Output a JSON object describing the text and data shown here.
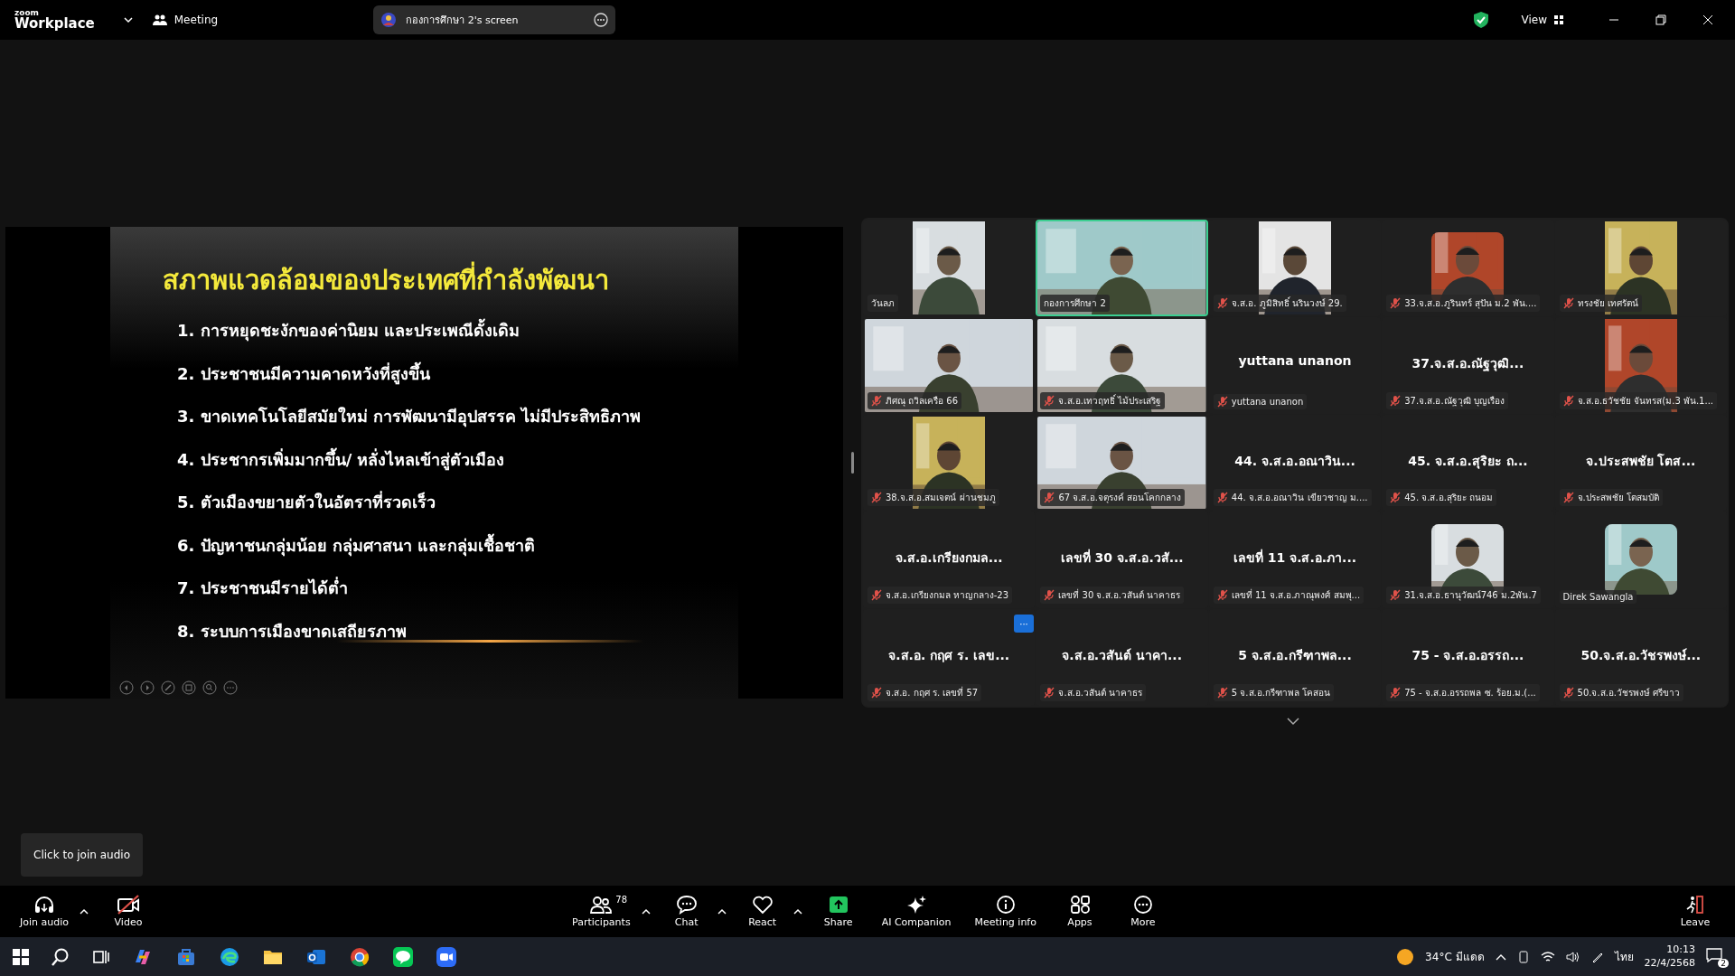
{
  "topbar": {
    "logo_small": "zoom",
    "logo_name": "Workplace",
    "meeting_label": "Meeting",
    "share_pill": "กองการศึกษา 2's screen",
    "view_label": "View"
  },
  "slide": {
    "title": "สภาพแวดล้อมของประเทศที่กำลังพัฒนา",
    "items": [
      "1. การหยุดชะงักของค่านิยม และประเพณีดั้งเดิม",
      "2. ประชาชนมีความคาดหวังที่สูงขึ้น",
      "3. ขาดเทคโนโลยีสมัยใหม่ การพัฒนามีอุปสรรค ไม่มีประสิทธิภาพ",
      "4. ประชากรเพิ่มมากขึ้น/ หลั่งไหลเข้าสู่ตัวเมือง",
      "5. ตัวเมืองขยายตัวในอัตราที่รวดเร็ว",
      "6. ปัญหาชนกลุ่มน้อย  กลุ่มศาสนา  และกลุ่มเชื้อชาติ",
      "7. ประชาชนมีรายได้ต่ำ",
      "8. ระบบการเมืองขาดเสถียรภาพ"
    ]
  },
  "gallery": {
    "more_button": "···",
    "tiles": [
      {
        "kind": "narrow",
        "label": "วันลภ",
        "muted": false,
        "selected": false
      },
      {
        "kind": "wide",
        "label": "กองการศึกษา 2",
        "muted": false,
        "selected": true
      },
      {
        "kind": "narrow",
        "label": "จ.ส.อ. ภูมิสิทธิ์ นรินวงษ์ 29.",
        "muted": true,
        "selected": false
      },
      {
        "label": "33.จ.ส.อ.ภูรินทร์ สุปัน ม.2 พัน....",
        "muted": true,
        "selected": false
      },
      {
        "kind": "narrow",
        "label": "ทรงชัย  เทศรัตน์",
        "muted": true,
        "selected": false
      },
      {
        "kind": "wide",
        "label": "ภิศณุ ถวิลเครือ  66",
        "muted": true,
        "selected": false
      },
      {
        "kind": "wide",
        "label": "จ.ส.อ.เทวฤทธิ์ ไม้ประเสริฐ",
        "muted": true,
        "selected": false
      },
      {
        "kind": "name",
        "display_name": "yuttana unanon",
        "label": "yuttana unanon",
        "muted": true,
        "selected": false
      },
      {
        "kind": "name",
        "display_name": "37.จ.ส.อ.ณัฐวุฒิ...",
        "label": "37.จ.ส.อ.ณัฐวุฒิ  บุญเรือง",
        "muted": true,
        "selected": false
      },
      {
        "kind": "narrow",
        "label": "จ.ส.อ.ธวัชชัย จันทรส(ม.3 พัน.1...",
        "muted": true,
        "selected": false
      },
      {
        "kind": "narrow",
        "label": "38.จ.ส.อ.สมเจตน์ ผ่านชมภู",
        "muted": true,
        "selected": false
      },
      {
        "kind": "wide",
        "label": "67 จ.ส.อ.จตุรงค์ สอนโคกกลาง",
        "muted": true,
        "selected": false
      },
      {
        "kind": "name",
        "display_name": "44. จ.ส.อ.อณาวิน...",
        "label": "44. จ.ส.อ.อณาวิน เขียวชาญ ม....",
        "muted": true,
        "selected": false
      },
      {
        "kind": "name",
        "display_name": "45. จ.ส.อ.สุริยะ ถ...",
        "label": "45. จ.ส.อ.สุริยะ ถนอม",
        "muted": true,
        "selected": false
      },
      {
        "kind": "name",
        "display_name": "จ.ประสพชัย โตส...",
        "label": "จ.ประสพชัย โตสมบัติ",
        "muted": true,
        "selected": false
      },
      {
        "kind": "name",
        "display_name": "จ.ส.อ.เกรียงกมล...",
        "label": "จ.ส.อ.เกรียงกมล หาญกลาง-23",
        "muted": true,
        "selected": false
      },
      {
        "kind": "name",
        "display_name": "เลขที่ 30 จ.ส.อ.วสั...",
        "label": "เลขที่ 30 จ.ส.อ.วสันต์  นาคาธร",
        "muted": true,
        "selected": false
      },
      {
        "kind": "name",
        "display_name": "เลขที่ 11 จ.ส.อ.ภา...",
        "label": "เลขที่ 11 จ.ส.อ.ภาณุพงศ์  สมพุ...",
        "muted": true,
        "selected": false
      },
      {
        "label": "31.จ.ส.อ.ธานุวัฒน์746 ม.2พัน.7",
        "muted": true,
        "selected": false
      },
      {
        "label": "Direk Sawangla",
        "muted": false,
        "selected": false
      },
      {
        "kind": "name",
        "display_name": "จ.ส.อ. กฤศ ร. เลข...",
        "label": "จ.ส.อ. กฤศ ร. เลขที่ 57",
        "muted": true,
        "selected": false
      },
      {
        "kind": "name",
        "display_name": "จ.ส.อ.วสันต์ นาคา...",
        "label": "จ.ส.อ.วสันต์ นาคาธร",
        "muted": true,
        "selected": false
      },
      {
        "kind": "name",
        "display_name": "5 จ.ส.อ.กรีฑาพล...",
        "label": "5 จ.ส.อ.กรีฑาพล  โคสอน",
        "muted": true,
        "selected": false
      },
      {
        "kind": "name",
        "display_name": "75 - จ.ส.อ.อรรถ...",
        "label": "75 - จ.ส.อ.อรรถพล ซ. ร้อย.ม.(...",
        "muted": true,
        "selected": false
      },
      {
        "kind": "name",
        "display_name": "50.จ.ส.อ.วัชรพงษ์...",
        "label": "50.จ.ส.อ.วัชรพงษ์ ศรีขาว",
        "muted": true,
        "selected": false
      }
    ]
  },
  "tooltip": "Click to join audio",
  "toolbar": {
    "left": [
      {
        "kind": "audio",
        "label": "Join audio",
        "dropdown": true
      },
      {
        "kind": "video",
        "label": "Video",
        "dropdown": false
      }
    ],
    "center": [
      {
        "kind": "participants",
        "label": "Participants",
        "count": "78",
        "dropdown": true
      },
      {
        "kind": "chat",
        "label": "Chat",
        "dropdown": true
      },
      {
        "kind": "react",
        "label": "React",
        "dropdown": true
      },
      {
        "kind": "share",
        "label": "Share",
        "dropdown": false
      },
      {
        "kind": "ai",
        "label": "AI Companion",
        "dropdown": false
      },
      {
        "kind": "info",
        "label": "Meeting info",
        "dropdown": false
      },
      {
        "kind": "apps",
        "label": "Apps",
        "dropdown": false
      },
      {
        "kind": "more",
        "label": "More",
        "dropdown": false
      }
    ],
    "right": [
      {
        "kind": "leave",
        "label": "Leave",
        "dropdown": false
      }
    ]
  },
  "taskbar": {
    "apps": [
      {
        "kind": "windows"
      },
      {
        "kind": "search"
      },
      {
        "kind": "taskview"
      },
      {
        "kind": "copilot"
      },
      {
        "kind": "store"
      },
      {
        "kind": "edge"
      },
      {
        "kind": "explorer"
      },
      {
        "kind": "outlook"
      },
      {
        "kind": "chrome"
      },
      {
        "kind": "line"
      },
      {
        "kind": "zoom"
      }
    ],
    "weather": {
      "temp": "34°C",
      "condition": "มีแดด"
    },
    "language": "ไทย",
    "time": "10:13",
    "date": "22/4/2568",
    "notifications": "2"
  }
}
